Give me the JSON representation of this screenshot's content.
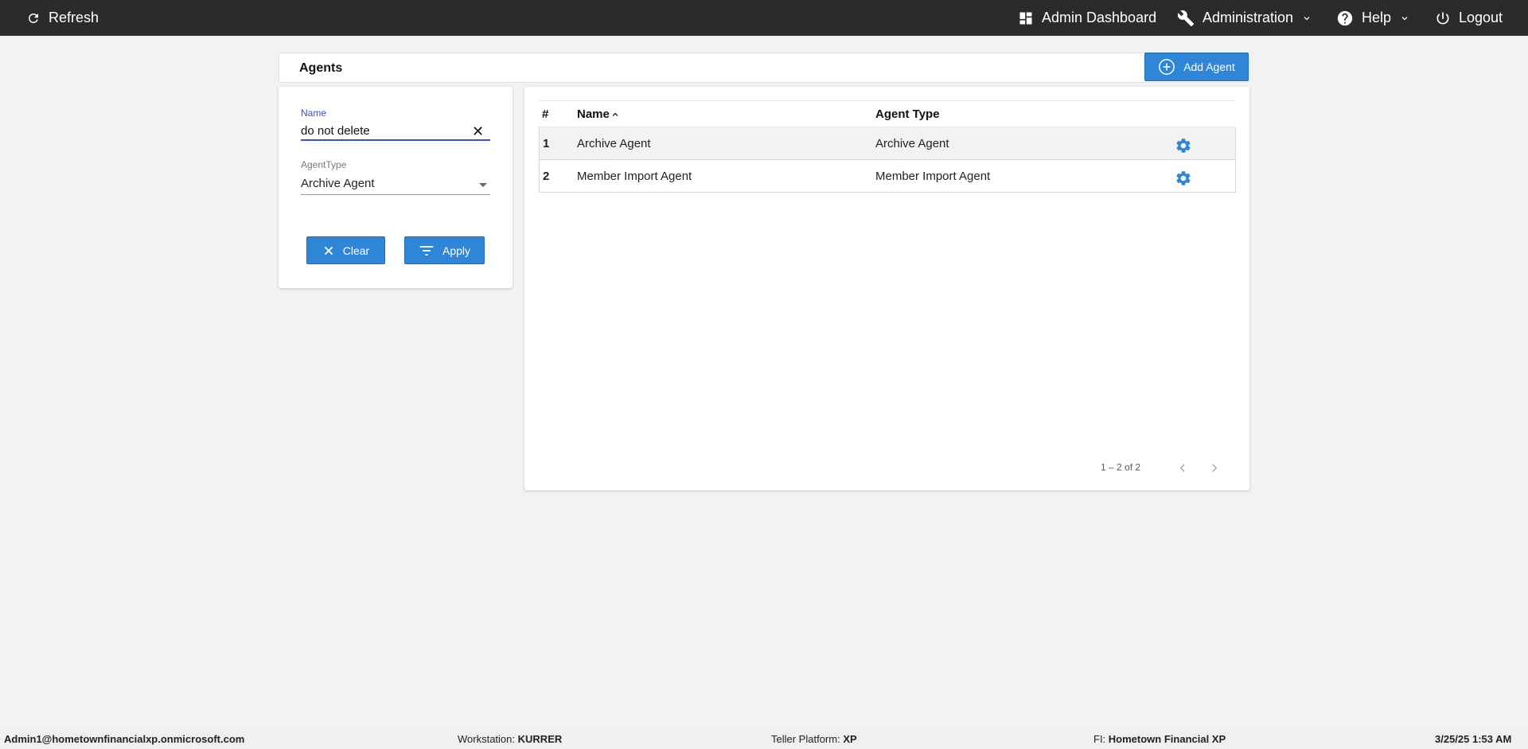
{
  "topbar": {
    "refresh": "Refresh",
    "admin_dashboard": "Admin Dashboard",
    "administration": "Administration",
    "help": "Help",
    "logout": "Logout"
  },
  "agents": {
    "title": "Agents",
    "add_button": "Add Agent"
  },
  "filter": {
    "name_label": "Name",
    "name_value": "do not delete",
    "type_label": "AgentType",
    "type_value": "Archive Agent",
    "clear_label": "Clear",
    "apply_label": "Apply"
  },
  "table": {
    "headers": {
      "num": "#",
      "name": "Name",
      "type": "Agent Type"
    },
    "rows": [
      {
        "num": "1",
        "name": "Archive Agent",
        "type": "Archive Agent"
      },
      {
        "num": "2",
        "name": "Member Import Agent",
        "type": "Member Import Agent"
      }
    ],
    "paginator": "1 – 2 of 2"
  },
  "status": {
    "user": "Admin1@hometownfinancialxp.onmicrosoft.com",
    "workstation_label": "Workstation:",
    "workstation": "KURRER",
    "platform_label": "Teller Platform:",
    "platform": "XP",
    "fi_label": "FI:",
    "fi": "Hometown Financial XP",
    "datetime": "3/25/25 1:53 AM"
  },
  "colors": {
    "accent": "#2f86d6",
    "topbar": "#2b2b2b",
    "input_focus": "#3f51b5"
  },
  "icons": [
    "refresh-icon",
    "dashboard-icon",
    "wrench-icon",
    "help-icon",
    "power-icon",
    "chevron-down-icon",
    "plus-circle-icon",
    "close-icon",
    "filter-icon",
    "gear-icon",
    "chevron-left-icon",
    "chevron-right-icon"
  ]
}
